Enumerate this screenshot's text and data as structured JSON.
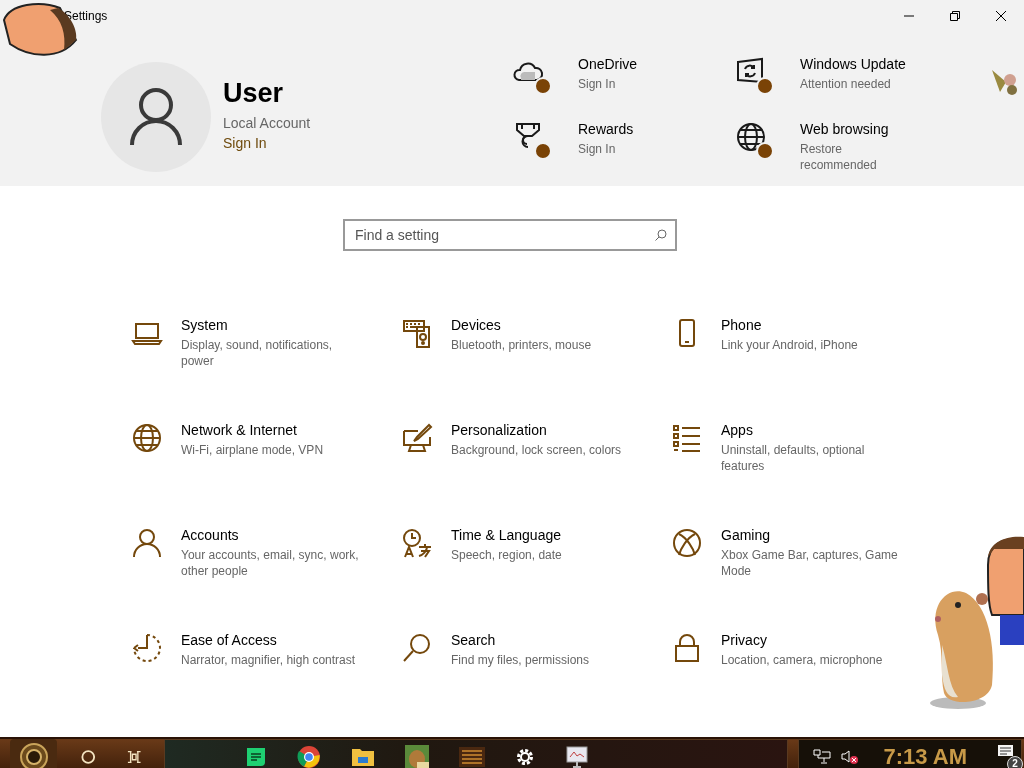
{
  "window": {
    "title": "Settings"
  },
  "account": {
    "name": "User",
    "type": "Local Account",
    "link": "Sign In"
  },
  "services": [
    {
      "kind": "cloud",
      "title": "OneDrive",
      "status": "Sign In"
    },
    {
      "kind": "update",
      "title": "Windows Update",
      "status": "Attention needed"
    },
    {
      "kind": "rewards",
      "title": "Rewards",
      "status": "Sign In"
    },
    {
      "kind": "globe",
      "title": "Web browsing",
      "status": "Restore recommended"
    }
  ],
  "search": {
    "placeholder": "Find a setting"
  },
  "categories": [
    {
      "kind": "laptop",
      "title": "System",
      "description": "Display, sound, notifications, power"
    },
    {
      "kind": "devices",
      "title": "Devices",
      "description": "Bluetooth, printers, mouse"
    },
    {
      "kind": "phone",
      "title": "Phone",
      "description": "Link your Android, iPhone"
    },
    {
      "kind": "globe",
      "title": "Network & Internet",
      "description": "Wi-Fi, airplane mode, VPN"
    },
    {
      "kind": "paint",
      "title": "Personalization",
      "description": "Background, lock screen, colors"
    },
    {
      "kind": "list",
      "title": "Apps",
      "description": "Uninstall, defaults, optional features"
    },
    {
      "kind": "person",
      "title": "Accounts",
      "description": "Your accounts, email, sync, work, other people"
    },
    {
      "kind": "language",
      "title": "Time & Language",
      "description": "Speech, region, date"
    },
    {
      "kind": "xbox",
      "title": "Gaming",
      "description": "Xbox Game Bar, captures, Game Mode"
    },
    {
      "kind": "access",
      "title": "Ease of Access",
      "description": "Narrator, magnifier, high contrast"
    },
    {
      "kind": "search",
      "title": "Search",
      "description": "Find my files, permissions"
    },
    {
      "kind": "lock",
      "title": "Privacy",
      "description": "Location, camera, microphone"
    }
  ],
  "taskbar": {
    "time": "7:13 AM",
    "notification_count": "2"
  }
}
